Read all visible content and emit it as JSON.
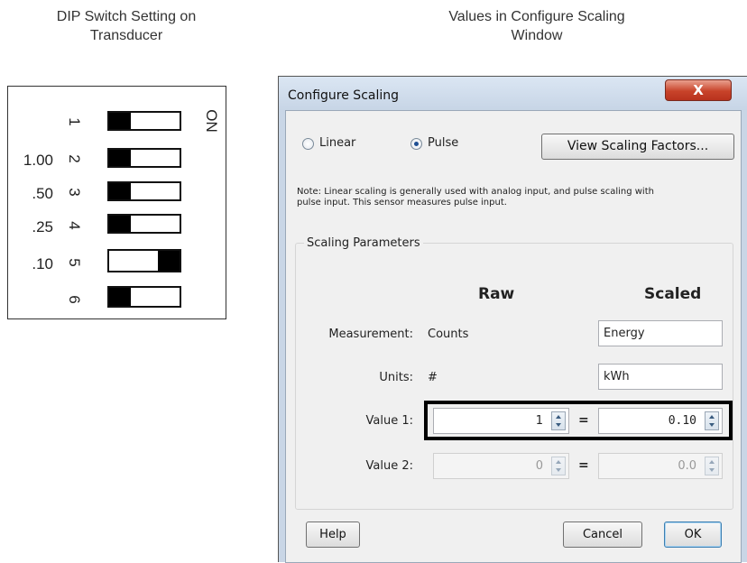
{
  "captions": {
    "left": "DIP Switch Setting on Transducer",
    "right": "Values in Configure Scaling Window"
  },
  "dip": {
    "on_label": "ON",
    "switches": [
      {
        "num": "1",
        "value": "",
        "state": "off"
      },
      {
        "num": "2",
        "value": "1.00",
        "state": "off"
      },
      {
        "num": "3",
        "value": ".50",
        "state": "off"
      },
      {
        "num": "4",
        "value": ".25",
        "state": "off"
      },
      {
        "num": "5",
        "value": ".10",
        "state": "on"
      },
      {
        "num": "6",
        "value": "",
        "state": "off"
      }
    ]
  },
  "dialog": {
    "title": "Configure Scaling",
    "close_glyph": "X",
    "radio_linear": "Linear",
    "radio_pulse": "Pulse",
    "selected_mode": "Pulse",
    "view_button": "View Scaling Factors...",
    "note": "Note: Linear scaling is generally used with analog input, and pulse scaling with pulse input. This sensor measures pulse input.",
    "group_title": "Scaling Parameters",
    "col_raw": "Raw",
    "col_scaled": "Scaled",
    "measurement_label": "Measurement:",
    "measurement_raw": "Counts",
    "measurement_scaled": "Energy",
    "units_label": "Units:",
    "units_raw": "#",
    "units_scaled": "kWh",
    "value1_label": "Value 1:",
    "value1_raw": "1",
    "value1_scaled": "0.10",
    "value2_label": "Value 2:",
    "value2_raw": "0",
    "value2_scaled": "0.0",
    "equals": "=",
    "help_button": "Help",
    "cancel_button": "Cancel",
    "ok_button": "OK"
  }
}
